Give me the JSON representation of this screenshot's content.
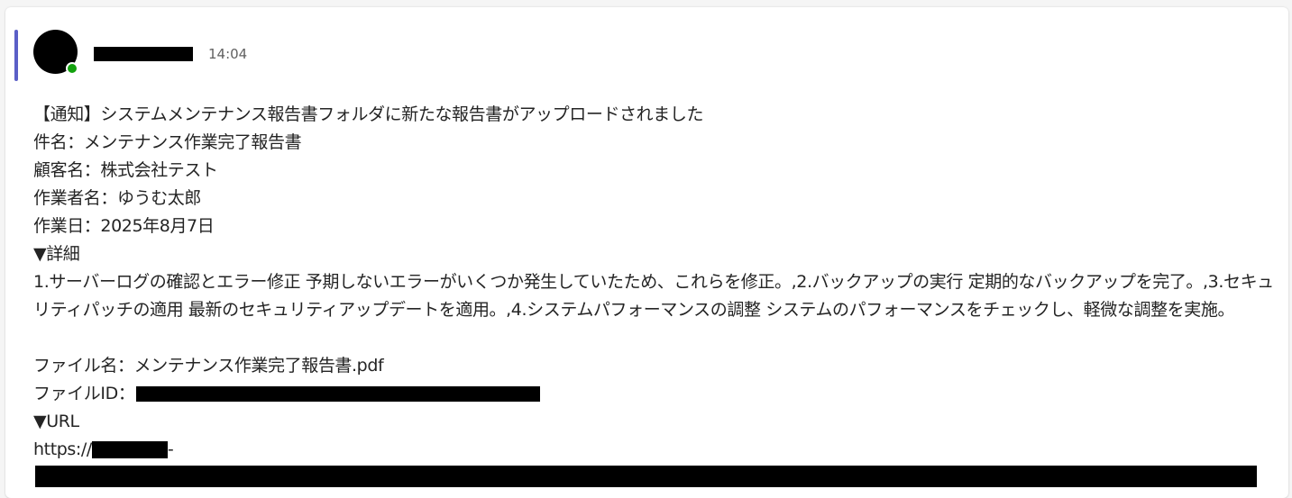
{
  "message": {
    "timestamp": "14:04",
    "lines": {
      "title": "【通知】システムメンテナンス報告書フォルダに新たな報告書がアップロードされました",
      "subject": "件名：メンテナンス作業完了報告書",
      "customer": "顧客名：株式会社テスト",
      "worker": "作業者名：ゆうむ太郎",
      "date": "作業日：2025年8月7日",
      "details_heading": "▼詳細",
      "details_body": "1.サーバーログの確認とエラー修正 予期しないエラーがいくつか発生していたため、これらを修正。,2.バックアップの実行 定期的なバックアップを完了。,3.セキュリティパッチの適用 最新のセキュリティアップデートを適用。,4.システムパフォーマンスの調整 システムのパフォーマンスをチェックし、軽微な調整を実施。",
      "file_name": "ファイル名：メンテナンス作業完了報告書.pdf",
      "file_id_label": "ファイルID：",
      "url_heading": "▼URL",
      "url_prefix": "https://",
      "url_suffix": "-"
    }
  },
  "colors": {
    "accent": "#5b5fc7",
    "presence_online": "#13a10e",
    "text": "#242424",
    "timestamp": "#616161"
  },
  "icons": {
    "presence": "presence-available-icon"
  }
}
